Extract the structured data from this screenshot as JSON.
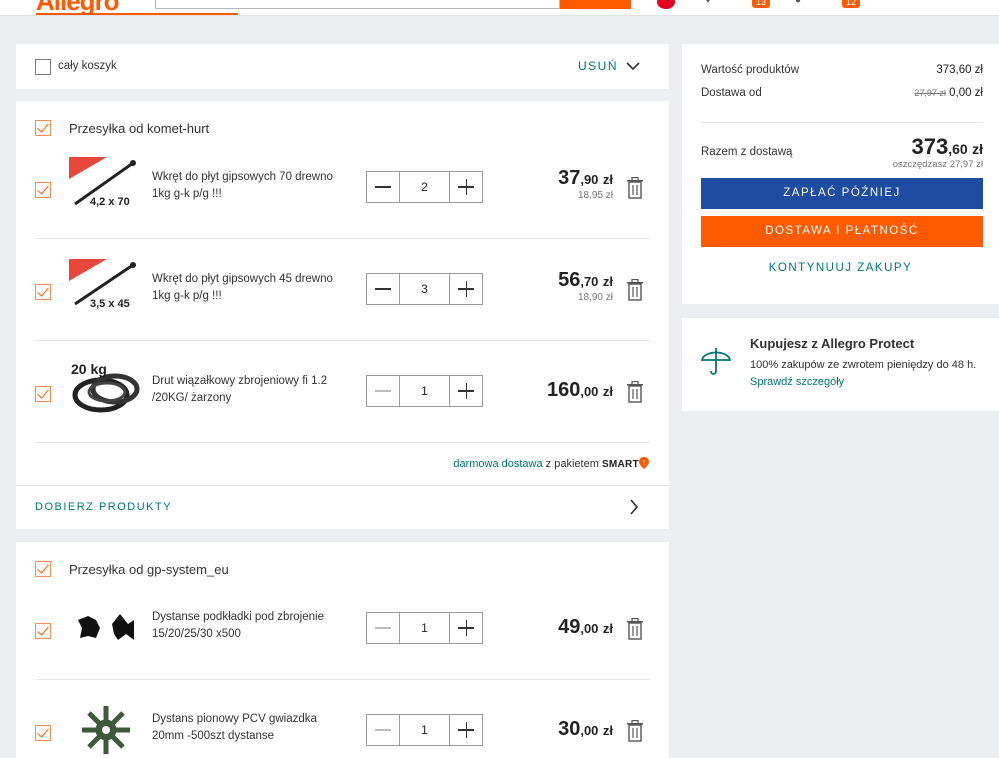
{
  "header": {
    "logo": "Allegro",
    "badges": [
      "13",
      "12"
    ]
  },
  "select_all": {
    "label": "cały koszyk",
    "remove_label": "USUŃ"
  },
  "groups": [
    {
      "seller": "Przesyłka od komet-hurt",
      "items": [
        {
          "name": "Wkręt do płyt gipsowych 70 drewno 1kg g-k p/g !!!",
          "image_label": "4,2 x 70",
          "qty": "2",
          "price_int": "37",
          "price_dec": ",90",
          "currency": "zł",
          "unit_price": "18,95 zł"
        },
        {
          "name": "Wkręt do płyt gipsowych 45 drewno 1kg g-k p/g !!!",
          "image_label": "3,5 x 45",
          "qty": "3",
          "price_int": "56",
          "price_dec": ",70",
          "currency": "zł",
          "unit_price": "18,90 zł"
        },
        {
          "name": "Drut wiązałkowy zbrojeniowy fi 1.2 /20KG/ żarzony",
          "image_label": "20 kg",
          "qty": "1",
          "price_int": "160",
          "price_dec": ",00",
          "currency": "zł",
          "unit_price": ""
        }
      ],
      "free_shipping": {
        "link": "darmowa dostawa",
        "text": "z pakietem",
        "brand": "SMART"
      },
      "pick_products": "DOBIERZ PRODUKTY"
    },
    {
      "seller": "Przesyłka od gp-system_eu",
      "items": [
        {
          "name": "Dystanse podkładki pod zbrojenie 15/20/25/30 x500",
          "qty": "1",
          "price_int": "49",
          "price_dec": ",00",
          "currency": "zł"
        },
        {
          "name": "Dystans pionowy PCV gwiazdka 20mm -500szt dystanse",
          "qty": "1",
          "price_int": "30",
          "price_dec": ",00",
          "currency": "zł"
        }
      ]
    }
  ],
  "summary": {
    "products_label": "Wartość produktów",
    "products_value": "373,60 zł",
    "delivery_label": "Dostawa od",
    "delivery_old": "27,97 zł",
    "delivery_value": "0,00 zł",
    "total_label": "Razem z dostawą",
    "total_int": "373",
    "total_dec": ",60",
    "total_currency": "zł",
    "saving": "oszczędzasz 27,97 zł",
    "pay_later": "ZAPŁAĆ PÓŹNIEJ",
    "delivery_payment": "DOSTAWA I PŁATNOŚĆ",
    "continue": "KONTYNUUJ ZAKUPY"
  },
  "protect": {
    "title": "Kupujesz z Allegro Protect",
    "text": "100% zakupów ze zwrotem pieniędzy do 48 h.",
    "link": "Sprawdź szczegóły"
  },
  "colors": {
    "accent": "#ff5a00",
    "teal": "#00747c",
    "blue": "#1e4ca1"
  }
}
